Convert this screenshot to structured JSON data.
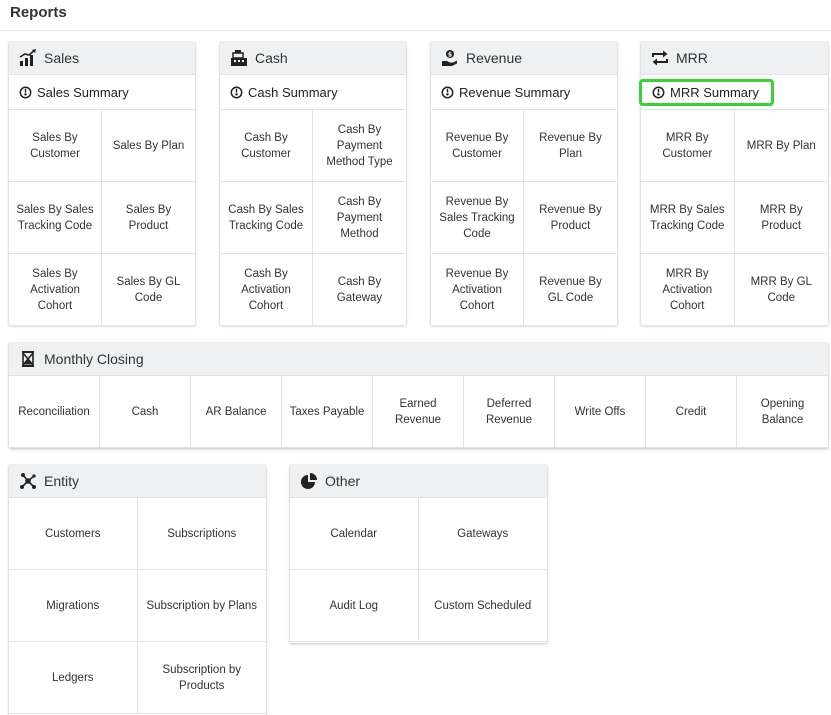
{
  "page": {
    "title": "Reports"
  },
  "sales": {
    "title": "Sales",
    "summary": "Sales Summary",
    "items": [
      "Sales By Customer",
      "Sales By Plan",
      "Sales By Sales Tracking Code",
      "Sales By Product",
      "Sales By Activation Cohort",
      "Sales By GL Code"
    ]
  },
  "cash": {
    "title": "Cash",
    "summary": "Cash Summary",
    "items": [
      "Cash By Customer",
      "Cash By Payment Method Type",
      "Cash By Sales Tracking Code",
      "Cash By Payment Method",
      "Cash By Activation Cohort",
      "Cash By Gateway"
    ]
  },
  "revenue": {
    "title": "Revenue",
    "summary": "Revenue Summary",
    "items": [
      "Revenue By Customer",
      "Revenue By Plan",
      "Revenue By Sales Tracking Code",
      "Revenue By Product",
      "Revenue By Activation Cohort",
      "Revenue By GL Code"
    ]
  },
  "mrr": {
    "title": "MRR",
    "summary": "MRR Summary",
    "items": [
      "MRR By Customer",
      "MRR By Plan",
      "MRR By Sales Tracking Code",
      "MRR By Product",
      "MRR By Activation Cohort",
      "MRR By GL Code"
    ]
  },
  "closing": {
    "title": "Monthly Closing",
    "items": [
      "Reconciliation",
      "Cash",
      "AR Balance",
      "Taxes Payable",
      "Earned Revenue",
      "Deferred Revenue",
      "Write Offs",
      "Credit",
      "Opening Balance"
    ]
  },
  "entity": {
    "title": "Entity",
    "items": [
      "Customers",
      "Subscriptions",
      "Migrations",
      "Subscription by Plans",
      "Ledgers",
      "Subscription by Products"
    ]
  },
  "other": {
    "title": "Other",
    "items": [
      "Calendar",
      "Gateways",
      "Audit Log",
      "Custom Scheduled"
    ]
  },
  "icons": {
    "sales": "bar-chart-icon",
    "cash": "cash-register-icon",
    "revenue": "hand-coin-icon",
    "mrr": "repeat-icon",
    "summary": "speedometer-icon",
    "closing": "hourglass-icon",
    "entity": "network-icon",
    "other": "pie-chart-icon"
  },
  "colors": {
    "highlight": "#36d233",
    "header_bg": "#eef0f2"
  }
}
